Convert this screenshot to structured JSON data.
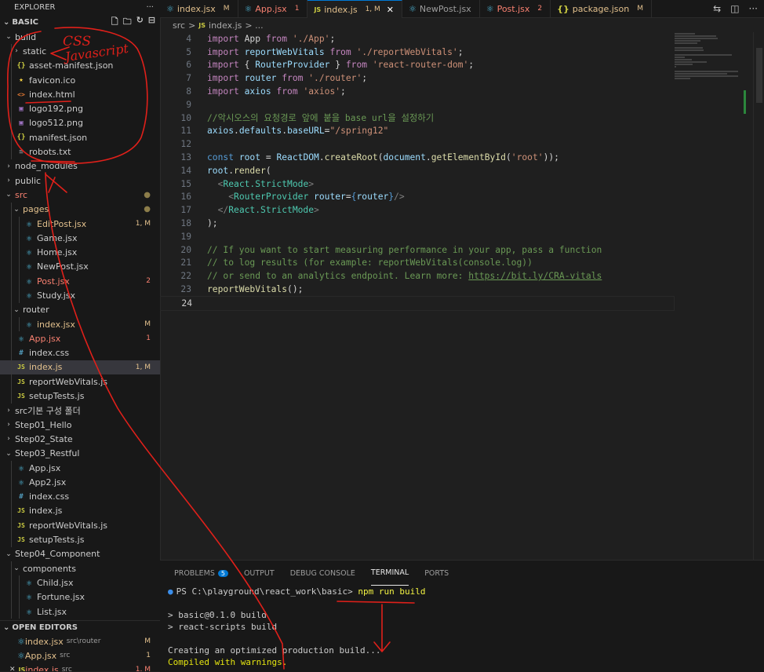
{
  "sidebar": {
    "title": "EXPLORER",
    "more": "···",
    "project": "BASIC",
    "tree": [
      {
        "label": "build",
        "kind": "folder-open",
        "depth": 0
      },
      {
        "label": "static",
        "kind": "folder-closed",
        "depth": 1
      },
      {
        "label": "asset-manifest.json",
        "kind": "json",
        "depth": 1
      },
      {
        "label": "favicon.ico",
        "kind": "star",
        "depth": 1
      },
      {
        "label": "index.html",
        "kind": "html",
        "depth": 1
      },
      {
        "label": "logo192.png",
        "kind": "img",
        "depth": 1
      },
      {
        "label": "logo512.png",
        "kind": "img",
        "depth": 1
      },
      {
        "label": "manifest.json",
        "kind": "json",
        "depth": 1
      },
      {
        "label": "robots.txt",
        "kind": "txt",
        "depth": 1
      },
      {
        "label": "node_modules",
        "kind": "folder-closed",
        "depth": 0
      },
      {
        "label": "public",
        "kind": "folder-closed",
        "depth": 0
      },
      {
        "label": "src",
        "kind": "folder-open",
        "depth": 0,
        "dot": true,
        "state": "error"
      },
      {
        "label": "pages",
        "kind": "folder-open",
        "depth": 1,
        "dot": true,
        "state": "modified"
      },
      {
        "label": "EditPost.jsx",
        "kind": "react",
        "depth": 2,
        "badge": "1, M",
        "state": "modified"
      },
      {
        "label": "Game.jsx",
        "kind": "react",
        "depth": 2
      },
      {
        "label": "Home.jsx",
        "kind": "react",
        "depth": 2
      },
      {
        "label": "NewPost.jsx",
        "kind": "react",
        "depth": 2
      },
      {
        "label": "Post.jsx",
        "kind": "react",
        "depth": 2,
        "badge": "2",
        "state": "error"
      },
      {
        "label": "Study.jsx",
        "kind": "react",
        "depth": 2
      },
      {
        "label": "router",
        "kind": "folder-open",
        "depth": 1
      },
      {
        "label": "index.jsx",
        "kind": "react",
        "depth": 2,
        "badge": "M",
        "state": "modified"
      },
      {
        "label": "App.jsx",
        "kind": "react",
        "depth": 1,
        "badge": "1",
        "state": "error"
      },
      {
        "label": "index.css",
        "kind": "css",
        "depth": 1
      },
      {
        "label": "index.js",
        "kind": "js",
        "depth": 1,
        "badge": "1, M",
        "state": "modified",
        "active": true
      },
      {
        "label": "reportWebVitals.js",
        "kind": "js",
        "depth": 1
      },
      {
        "label": "setupTests.js",
        "kind": "js",
        "depth": 1
      },
      {
        "label": "src기본 구성 폴더",
        "kind": "folder-closed",
        "depth": 0
      },
      {
        "label": "Step01_Hello",
        "kind": "folder-closed",
        "depth": 0
      },
      {
        "label": "Step02_State",
        "kind": "folder-closed",
        "depth": 0
      },
      {
        "label": "Step03_Restful",
        "kind": "folder-open",
        "depth": 0
      },
      {
        "label": "App.jsx",
        "kind": "react",
        "depth": 1
      },
      {
        "label": "App2.jsx",
        "kind": "react",
        "depth": 1
      },
      {
        "label": "index.css",
        "kind": "css",
        "depth": 1
      },
      {
        "label": "index.js",
        "kind": "js",
        "depth": 1
      },
      {
        "label": "reportWebVitals.js",
        "kind": "js",
        "depth": 1
      },
      {
        "label": "setupTests.js",
        "kind": "js",
        "depth": 1
      },
      {
        "label": "Step04_Component",
        "kind": "folder-open",
        "depth": 0
      },
      {
        "label": "components",
        "kind": "folder-open",
        "depth": 1
      },
      {
        "label": "Child.jsx",
        "kind": "react",
        "depth": 2
      },
      {
        "label": "Fortune.jsx",
        "kind": "react",
        "depth": 2
      },
      {
        "label": "List.jsx",
        "kind": "react",
        "depth": 2
      }
    ]
  },
  "open_editors": {
    "title": "OPEN EDITORS",
    "items": [
      {
        "name": "index.jsx",
        "path": "src\\router",
        "badge": "M",
        "state": "modified"
      },
      {
        "name": "App.jsx",
        "path": "src",
        "badge": "1",
        "state": "modified"
      },
      {
        "name": "index.js",
        "path": "src",
        "badge": "1, M",
        "state": "error"
      }
    ]
  },
  "tabs": [
    {
      "name": "index.jsx",
      "badge": "M",
      "kind": "react",
      "state": "modified"
    },
    {
      "name": "App.jsx",
      "badge": "1",
      "kind": "react",
      "state": "error"
    },
    {
      "name": "index.js",
      "badge": "1, M",
      "kind": "js",
      "state": "modified",
      "active": true,
      "close": "✕"
    },
    {
      "name": "NewPost.jsx",
      "badge": "",
      "kind": "react"
    },
    {
      "name": "Post.jsx",
      "badge": "2",
      "kind": "react",
      "state": "error"
    },
    {
      "name": "package.json",
      "badge": "M",
      "kind": "json",
      "state": "modified"
    }
  ],
  "breadcrumb": {
    "folder": "src",
    "sep": ">",
    "file_icon": "JS",
    "file": "index.js",
    "tail": "> ..."
  },
  "editor": {
    "lines": [
      {
        "n": "4",
        "tokens": [
          [
            "kw",
            "import "
          ],
          [
            "code",
            "App"
          ],
          [
            "kw",
            " from "
          ],
          [
            "str",
            "'./App'"
          ],
          [
            "code",
            ";"
          ]
        ]
      },
      {
        "n": "5",
        "tokens": [
          [
            "kw",
            "import "
          ],
          [
            "vr",
            "reportWebVitals"
          ],
          [
            "kw",
            " from "
          ],
          [
            "str",
            "'./reportWebVitals'"
          ],
          [
            "code",
            ";"
          ]
        ]
      },
      {
        "n": "6",
        "tokens": [
          [
            "kw",
            "import "
          ],
          [
            "code",
            "{ "
          ],
          [
            "vr",
            "RouterProvider"
          ],
          [
            "code",
            " } "
          ],
          [
            "kw",
            "from "
          ],
          [
            "str",
            "'react-router-dom'"
          ],
          [
            "code",
            ";"
          ]
        ]
      },
      {
        "n": "7",
        "tokens": [
          [
            "kw",
            "import "
          ],
          [
            "vr",
            "router"
          ],
          [
            "kw",
            " from "
          ],
          [
            "str",
            "'./router'"
          ],
          [
            "code",
            ";"
          ]
        ]
      },
      {
        "n": "8",
        "tokens": [
          [
            "kw",
            "import "
          ],
          [
            "vr",
            "axios"
          ],
          [
            "kw",
            " from "
          ],
          [
            "str",
            "'axios'"
          ],
          [
            "code",
            ";"
          ]
        ]
      },
      {
        "n": "9",
        "tokens": []
      },
      {
        "n": "10",
        "tokens": [
          [
            "cmt",
            "//악시오스의 요청경로 앞에 붙을 base url을 설정하기"
          ]
        ]
      },
      {
        "n": "11",
        "tokens": [
          [
            "vr",
            "axios"
          ],
          [
            "code",
            "."
          ],
          [
            "vr",
            "defaults"
          ],
          [
            "code",
            "."
          ],
          [
            "vr",
            "baseURL"
          ],
          [
            "code",
            "="
          ],
          [
            "str",
            "\"/spring12\""
          ]
        ]
      },
      {
        "n": "12",
        "tokens": []
      },
      {
        "n": "13",
        "tokens": [
          [
            "brace",
            "const "
          ],
          [
            "vr",
            "root"
          ],
          [
            "code",
            " = "
          ],
          [
            "vr",
            "ReactDOM"
          ],
          [
            "code",
            "."
          ],
          [
            "fn",
            "createRoot"
          ],
          [
            "code",
            "("
          ],
          [
            "vr",
            "document"
          ],
          [
            "code",
            "."
          ],
          [
            "fn",
            "getElementById"
          ],
          [
            "code",
            "("
          ],
          [
            "str",
            "'root'"
          ],
          [
            "code",
            "));"
          ]
        ]
      },
      {
        "n": "14",
        "tokens": [
          [
            "vr",
            "root"
          ],
          [
            "code",
            "."
          ],
          [
            "fn",
            "render"
          ],
          [
            "code",
            "("
          ]
        ]
      },
      {
        "n": "15",
        "tokens": [
          [
            "code",
            "  "
          ],
          [
            "ang",
            "<"
          ],
          [
            "tag",
            "React.StrictMode"
          ],
          [
            "ang",
            ">"
          ]
        ]
      },
      {
        "n": "16",
        "tokens": [
          [
            "code",
            "    "
          ],
          [
            "ang",
            "<"
          ],
          [
            "tag",
            "RouterProvider"
          ],
          [
            "attr",
            " router"
          ],
          [
            "code",
            "="
          ],
          [
            "brace",
            "{"
          ],
          [
            "vr",
            "router"
          ],
          [
            "brace",
            "}"
          ],
          [
            "ang",
            "/>"
          ]
        ]
      },
      {
        "n": "17",
        "tokens": [
          [
            "code",
            "  "
          ],
          [
            "ang",
            "</"
          ],
          [
            "tag",
            "React.StrictMode"
          ],
          [
            "ang",
            ">"
          ]
        ]
      },
      {
        "n": "18",
        "tokens": [
          [
            "code",
            ");"
          ]
        ]
      },
      {
        "n": "19",
        "tokens": []
      },
      {
        "n": "20",
        "tokens": [
          [
            "cmt",
            "// If you want to start measuring performance in your app, pass a function"
          ]
        ]
      },
      {
        "n": "21",
        "tokens": [
          [
            "cmt",
            "// to log results (for example: reportWebVitals(console.log))"
          ]
        ]
      },
      {
        "n": "22",
        "tokens": [
          [
            "cmt",
            "// or send to an analytics endpoint. Learn more: "
          ],
          [
            "link",
            "https://bit.ly/CRA-vitals"
          ]
        ]
      },
      {
        "n": "23",
        "tokens": [
          [
            "fn",
            "reportWebVitals"
          ],
          [
            "code",
            "();"
          ]
        ]
      },
      {
        "n": "24",
        "tokens": [],
        "current": true
      }
    ]
  },
  "panel": {
    "tabs": [
      {
        "label": "PROBLEMS",
        "count": "5"
      },
      {
        "label": "OUTPUT"
      },
      {
        "label": "DEBUG CONSOLE"
      },
      {
        "label": "TERMINAL",
        "active": true
      },
      {
        "label": "PORTS"
      }
    ],
    "terminal": {
      "prompt": "PS C:\\playground\\react_work\\basic> ",
      "command": "npm run build",
      "lines": [
        "",
        "> basic@0.1.0 build",
        "> react-scripts build",
        "",
        "Creating an optimized production build..."
      ],
      "warning": "Compiled with warnings."
    }
  },
  "annotations": {
    "css_note": "CSS",
    "js_note": "Javascript",
    "ink_color": "#e0201a"
  }
}
